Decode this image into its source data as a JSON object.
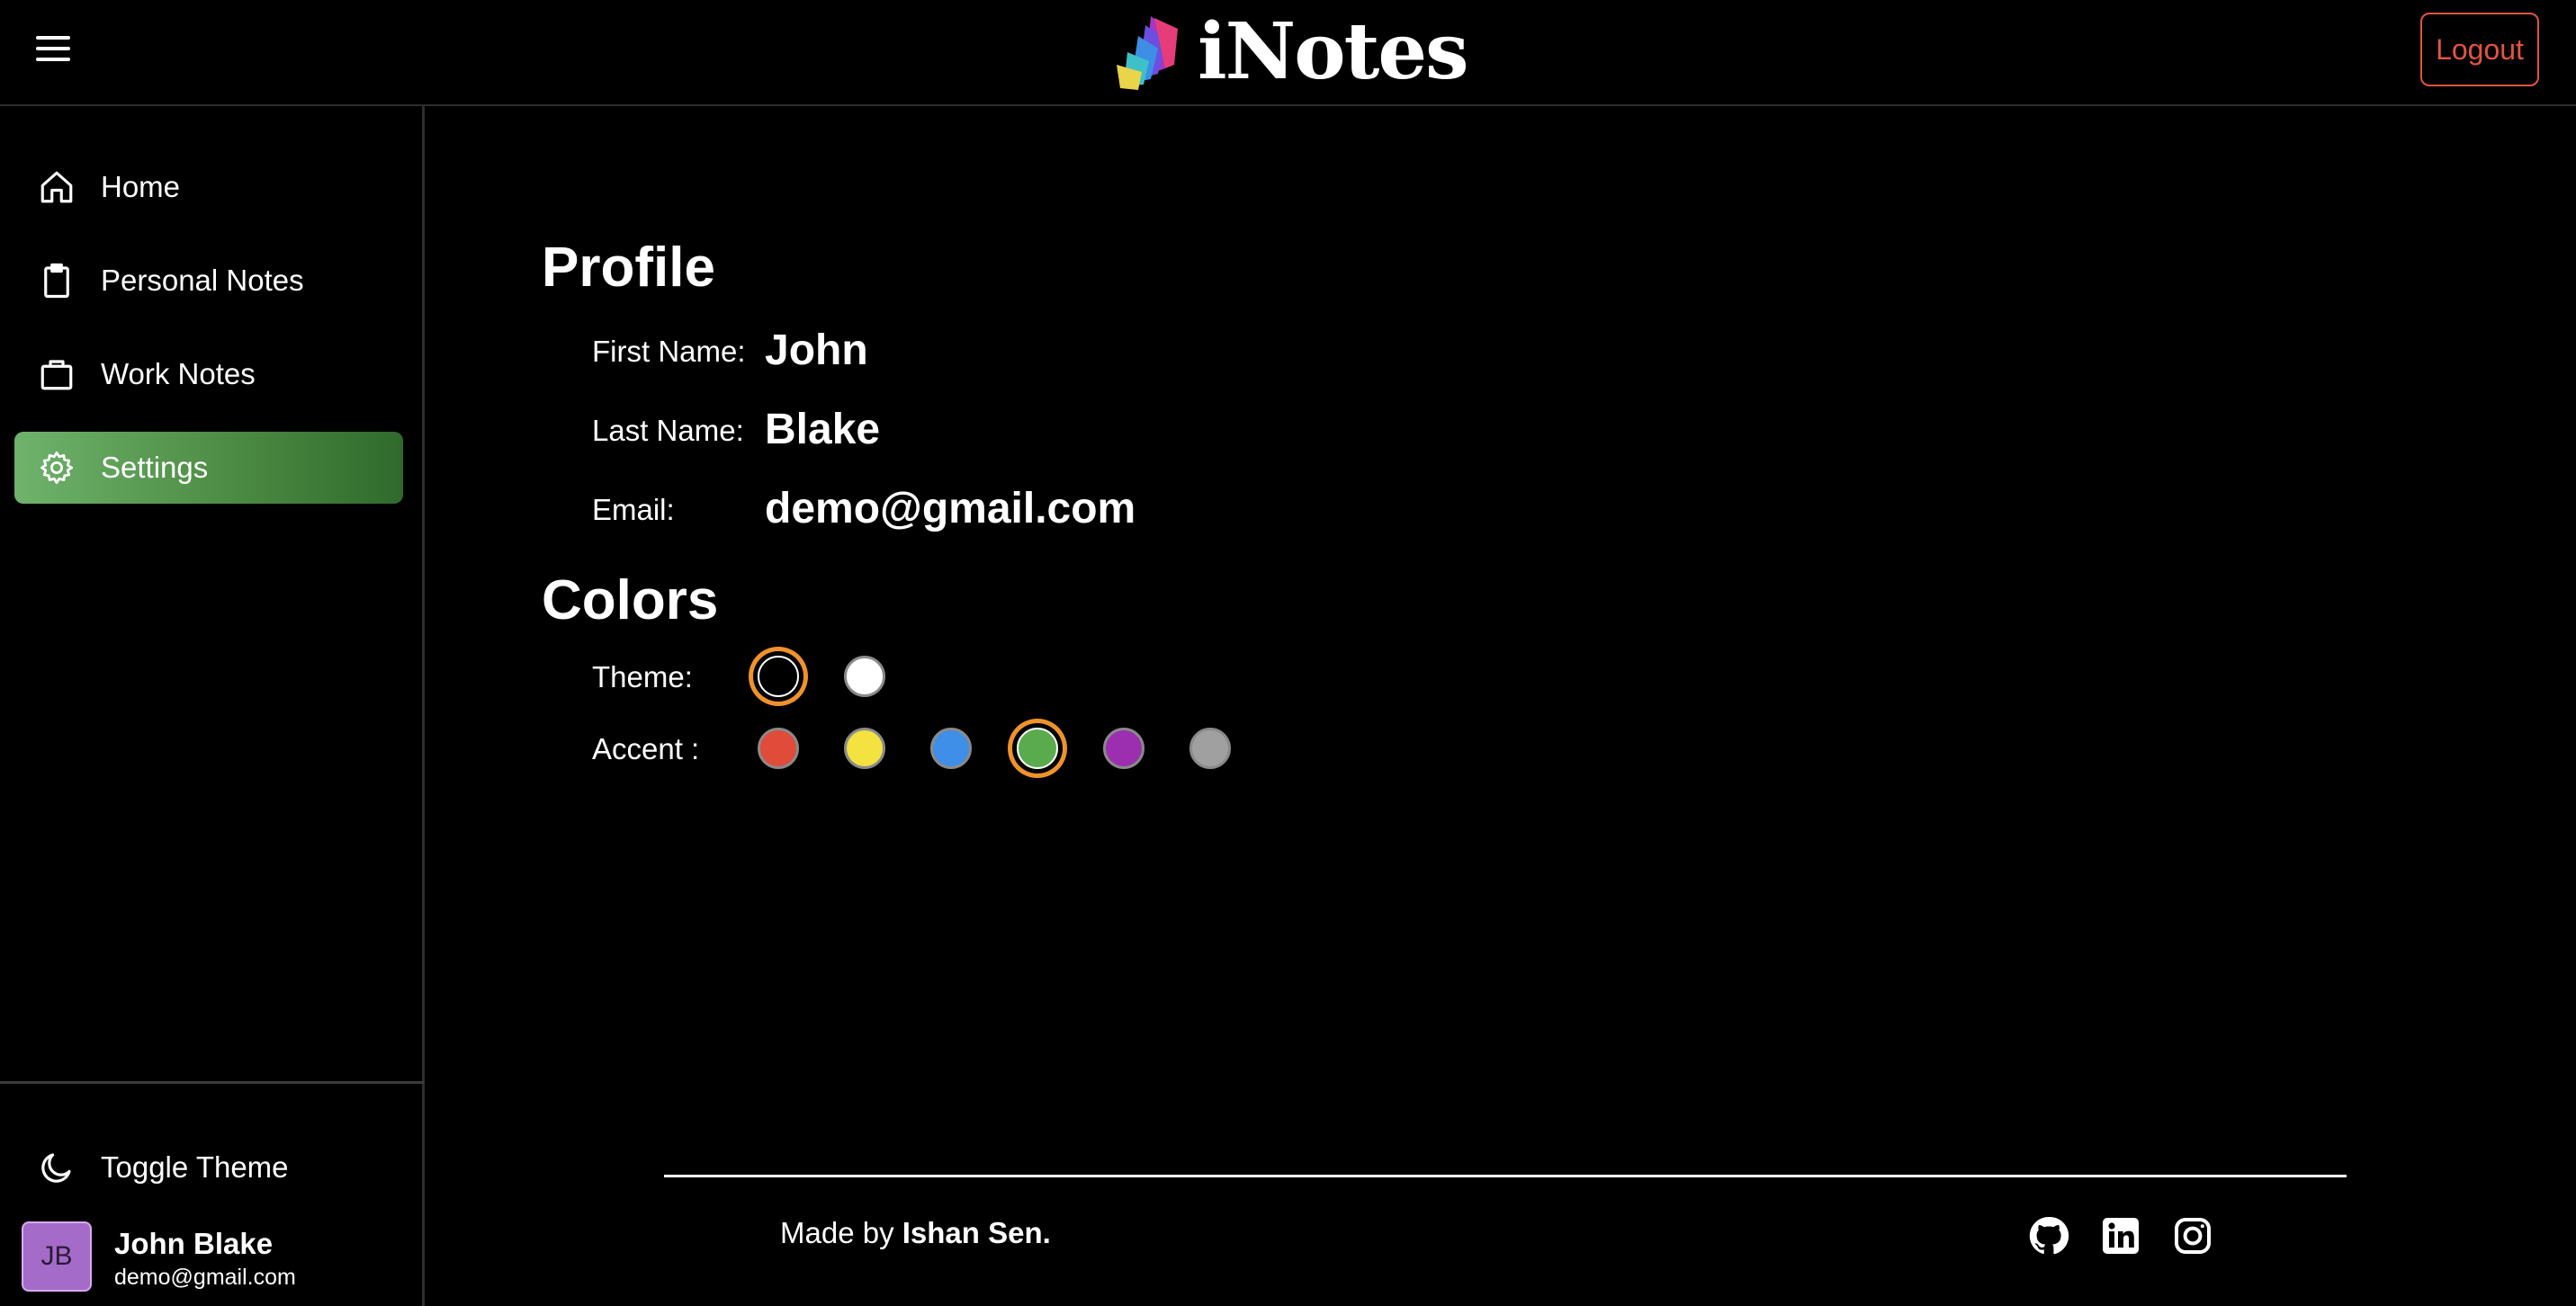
{
  "header": {
    "menu_icon": "hamburger-menu-icon",
    "brand_name": "iNotes",
    "logout_label": "Logout"
  },
  "sidebar": {
    "items": [
      {
        "label": "Home",
        "icon": "home-icon",
        "active": false
      },
      {
        "label": "Personal Notes",
        "icon": "clipboard-icon",
        "active": false
      },
      {
        "label": "Work Notes",
        "icon": "briefcase-icon",
        "active": false
      },
      {
        "label": "Settings",
        "icon": "gear-icon",
        "active": true
      }
    ],
    "toggle_theme_label": "Toggle Theme",
    "user": {
      "initials": "JB",
      "name": "John Blake",
      "email": "demo@gmail.com"
    }
  },
  "profile": {
    "title": "Profile",
    "first_name_label": "First Name:",
    "first_name": "John",
    "last_name_label": "Last Name:",
    "last_name": "Blake",
    "email_label": "Email:",
    "email": "demo@gmail.com"
  },
  "colors": {
    "title": "Colors",
    "theme_label": "Theme:",
    "theme_options": [
      {
        "color": "#000000",
        "selected": true
      },
      {
        "color": "#ffffff",
        "selected": false
      }
    ],
    "accent_label": "Accent :",
    "accent_options": [
      {
        "color": "#e04b3a",
        "selected": false
      },
      {
        "color": "#f3e23f",
        "selected": false
      },
      {
        "color": "#3f8ee8",
        "selected": false
      },
      {
        "color": "#5aab4e",
        "selected": true
      },
      {
        "color": "#9b2fb0",
        "selected": false
      },
      {
        "color": "#a0a0a0",
        "selected": false
      }
    ],
    "selection_ring_color": "#f0922b"
  },
  "footer": {
    "made_by_prefix": "Made by",
    "author": "Ishan Sen.",
    "social_icons": [
      "github-icon",
      "linkedin-icon",
      "instagram-icon"
    ]
  }
}
